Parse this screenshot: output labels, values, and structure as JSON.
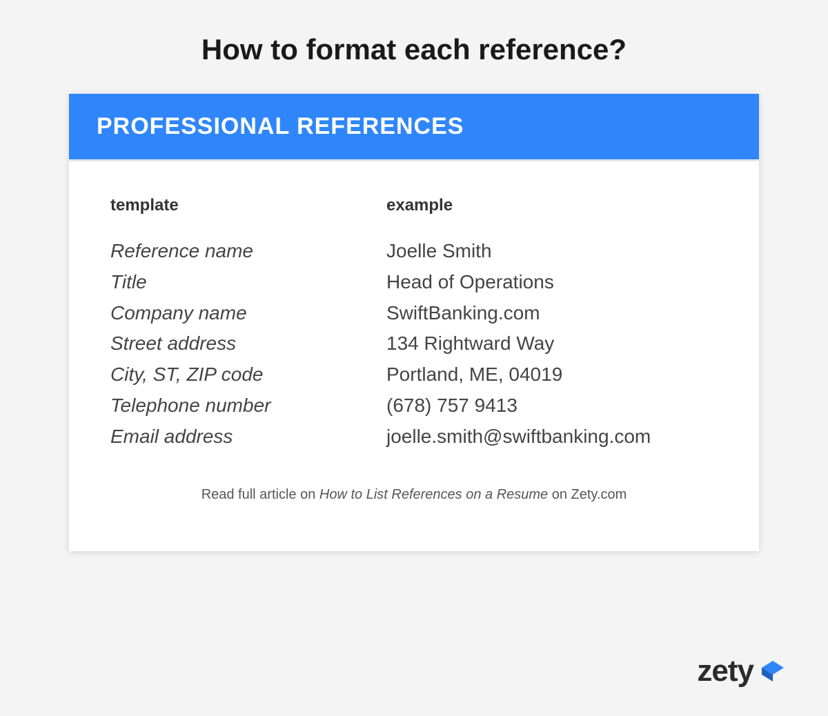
{
  "title": "How to format each reference?",
  "card": {
    "header": "PROFESSIONAL REFERENCES",
    "template_heading": "template",
    "example_heading": "example",
    "template_lines": [
      "Reference name",
      "Title",
      "Company name",
      "Street address",
      "City, ST, ZIP code",
      "Telephone number",
      "Email address"
    ],
    "example_lines": [
      "Joelle Smith",
      "Head of Operations",
      "SwiftBanking.com",
      "134 Rightward Way",
      "Portland, ME, 04019",
      "(678) 757 9413",
      "joelle.smith@swiftbanking.com"
    ]
  },
  "footer": {
    "prefix": "Read full article on ",
    "article": "How to List References on a Resume",
    "suffix": " on Zety.com"
  },
  "brand": {
    "name": "zety",
    "accent": "#2f86fa"
  }
}
